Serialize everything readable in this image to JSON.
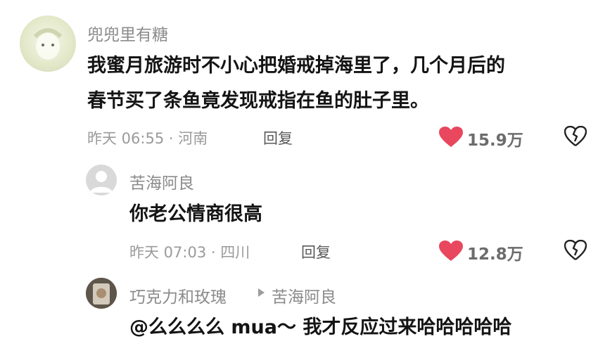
{
  "comments": [
    {
      "username": "兜兜里有糖",
      "content_line1": "我蜜月旅游时不小心把婚戒掉海里了，几个月后的",
      "content_line2": "春节买了条鱼竟发现戒指在鱼的肚子里。",
      "meta": "昨天 06:55 · 河南",
      "reply_label": "回复",
      "likes": "15.9万"
    },
    {
      "username": "苦海阿良",
      "content": "你老公情商很高",
      "meta": "昨天 07:03 · 四川",
      "reply_label": "回复",
      "likes": "12.8万"
    },
    {
      "username": "巧克力和玫瑰",
      "reply_to": "苦海阿良",
      "content": "@么么么么 mua～ 我才反应过来哈哈哈哈哈"
    }
  ],
  "colors": {
    "like_heart": "#e8475e",
    "dislike_icon": "#222222",
    "username": "#8b8b8b"
  },
  "icons": [
    "avatar",
    "heart-icon",
    "broken-heart-icon",
    "reply-arrow-icon"
  ]
}
